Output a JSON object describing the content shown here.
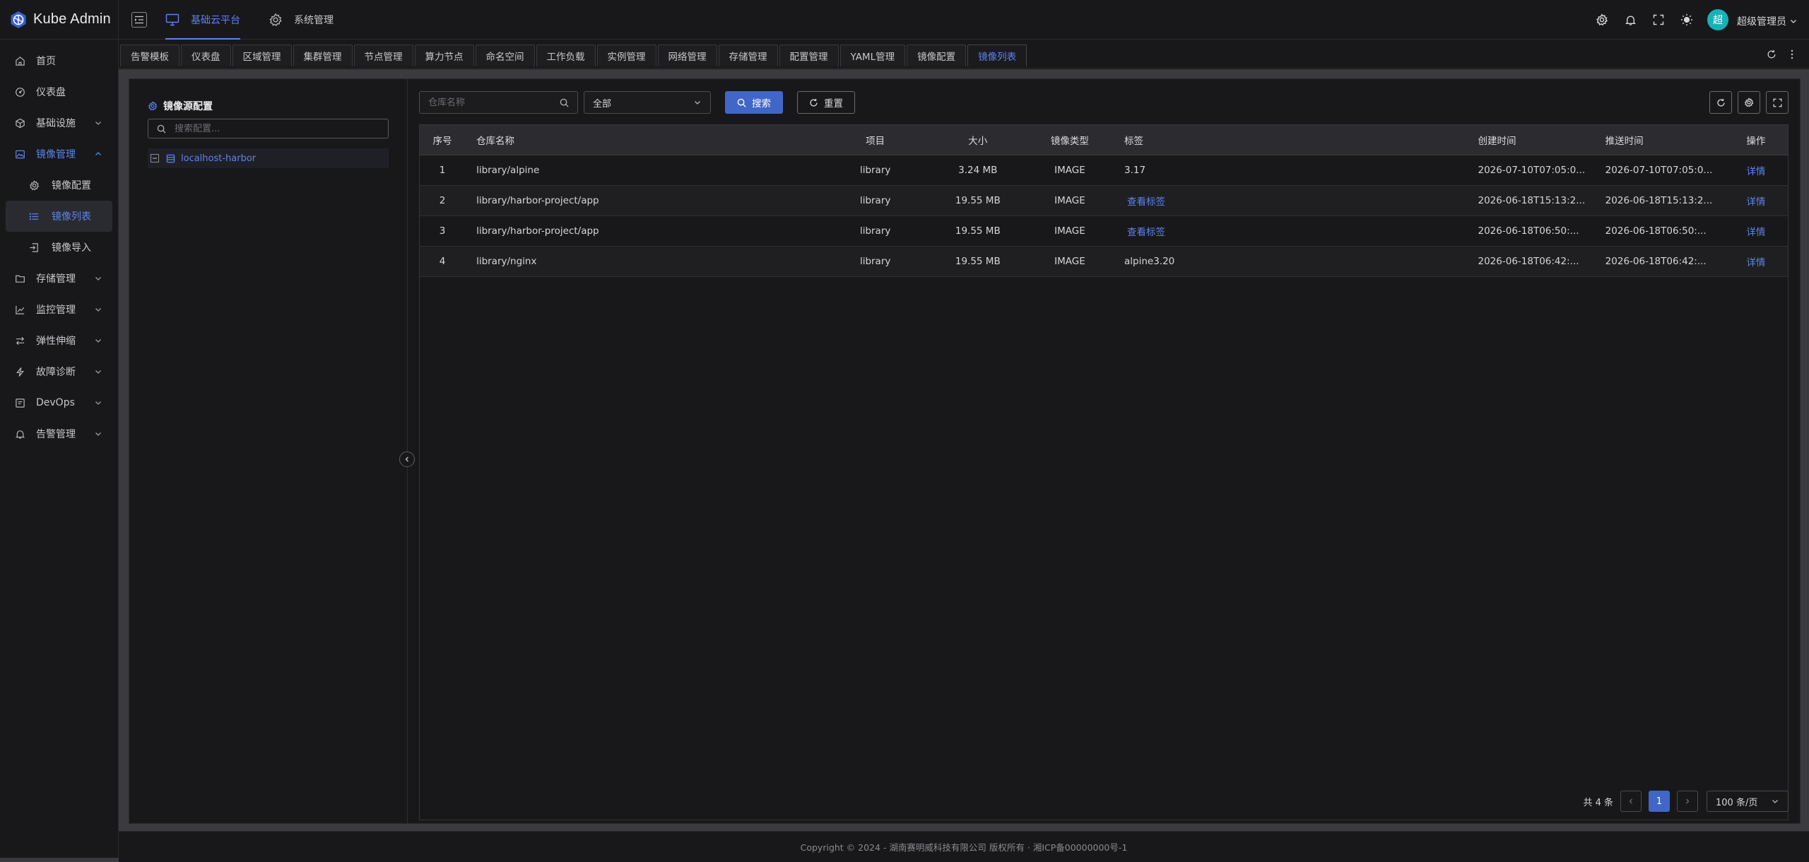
{
  "app": {
    "title": "Kube Admin"
  },
  "sidebar": {
    "items": [
      {
        "label": "首页",
        "icon": "home-icon"
      },
      {
        "label": "仪表盘",
        "icon": "dashboard-icon"
      },
      {
        "label": "基础设施",
        "icon": "cube-icon"
      },
      {
        "label": "镜像管理",
        "icon": "image-icon",
        "open": true
      },
      {
        "label": "存储管理",
        "icon": "folder-icon"
      },
      {
        "label": "监控管理",
        "icon": "chart-icon"
      },
      {
        "label": "弹性伸缩",
        "icon": "swap-icon"
      },
      {
        "label": "故障诊断",
        "icon": "bolt-icon"
      },
      {
        "label": "DevOps",
        "icon": "devops-icon"
      },
      {
        "label": "告警管理",
        "icon": "bell-icon"
      }
    ],
    "submenu": [
      {
        "label": "镜像配置",
        "icon": "gear-icon"
      },
      {
        "label": "镜像列表",
        "icon": "list-icon",
        "active": true
      },
      {
        "label": "镜像导入",
        "icon": "import-icon"
      }
    ]
  },
  "header": {
    "platform_tabs": [
      {
        "label": "基础云平台",
        "active": true
      },
      {
        "label": "系统管理"
      }
    ],
    "user": {
      "avatar_text": "超",
      "name": "超级管理员"
    }
  },
  "tabs": [
    "告警模板",
    "仪表盘",
    "区域管理",
    "集群管理",
    "节点管理",
    "算力节点",
    "命名空间",
    "工作负载",
    "实例管理",
    "网络管理",
    "存储管理",
    "配置管理",
    "YAML管理",
    "镜像配置",
    "镜像列表"
  ],
  "tree": {
    "title": "镜像源配置",
    "search_placeholder": "搜索配置...",
    "node": "localhost-harbor"
  },
  "filters": {
    "repo_placeholder": "仓库名称",
    "type_value": "全部",
    "search_label": "搜索",
    "reset_label": "重置"
  },
  "table": {
    "columns": [
      "序号",
      "仓库名称",
      "项目",
      "大小",
      "镜像类型",
      "标签",
      "创建时间",
      "推送时间",
      "操作"
    ],
    "rows": [
      {
        "no": "1",
        "repo": "library/alpine",
        "project": "library",
        "size": "3.24 MB",
        "type": "IMAGE",
        "tag": "3.17",
        "tag_link": false,
        "created": "2026-07-10T07:05:0...",
        "pushed": "2026-07-10T07:05:0...",
        "action": "详情"
      },
      {
        "no": "2",
        "repo": "library/harbor-project/app",
        "project": "library",
        "size": "19.55 MB",
        "type": "IMAGE",
        "tag": "查看标签",
        "tag_link": true,
        "created": "2026-06-18T15:13:2...",
        "pushed": "2026-06-18T15:13:2...",
        "action": "详情"
      },
      {
        "no": "3",
        "repo": "library/harbor-project/app",
        "project": "library",
        "size": "19.55 MB",
        "type": "IMAGE",
        "tag": "查看标签",
        "tag_link": true,
        "created": "2026-06-18T06:50:...",
        "pushed": "2026-06-18T06:50:...",
        "action": "详情"
      },
      {
        "no": "4",
        "repo": "library/nginx",
        "project": "library",
        "size": "19.55 MB",
        "type": "IMAGE",
        "tag": "alpine3.20",
        "tag_link": false,
        "created": "2026-06-18T06:42:...",
        "pushed": "2026-06-18T06:42:...",
        "action": "详情"
      }
    ]
  },
  "pagination": {
    "total": "共 4 条",
    "current": "1",
    "page_size": "100 条/页"
  },
  "footer": {
    "text": "Copyright © 2024 - 湖南赛明威科技有限公司 版权所有 · 湘ICP备00000000号-1"
  },
  "colors": {
    "accent": "#5b83ee",
    "primary_button": "#4066c8",
    "avatar": "#17b1b8"
  }
}
